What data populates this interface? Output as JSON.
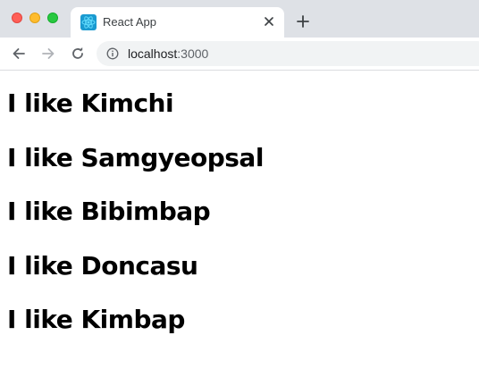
{
  "browser": {
    "tab_title": "React App",
    "url_host": "localhost",
    "url_port": ":3000",
    "icons": {
      "close_window": "traffic-light-close",
      "minimize_window": "traffic-light-minimize",
      "maximize_window": "traffic-light-maximize",
      "favicon": "react-logo",
      "tab_close": "close-icon",
      "new_tab": "plus-icon",
      "back": "arrow-left-icon",
      "forward": "arrow-right-icon",
      "reload": "reload-icon",
      "site_info": "info-icon"
    },
    "colors": {
      "tabstrip": "#dee1e6",
      "omnibox": "#f1f3f4",
      "react_blue": "#61dafb"
    }
  },
  "page": {
    "foods": [
      "I like Kimchi",
      "I like Samgyeopsal",
      "I like Bibimbap",
      "I like Doncasu",
      "I like Kimbap"
    ]
  }
}
